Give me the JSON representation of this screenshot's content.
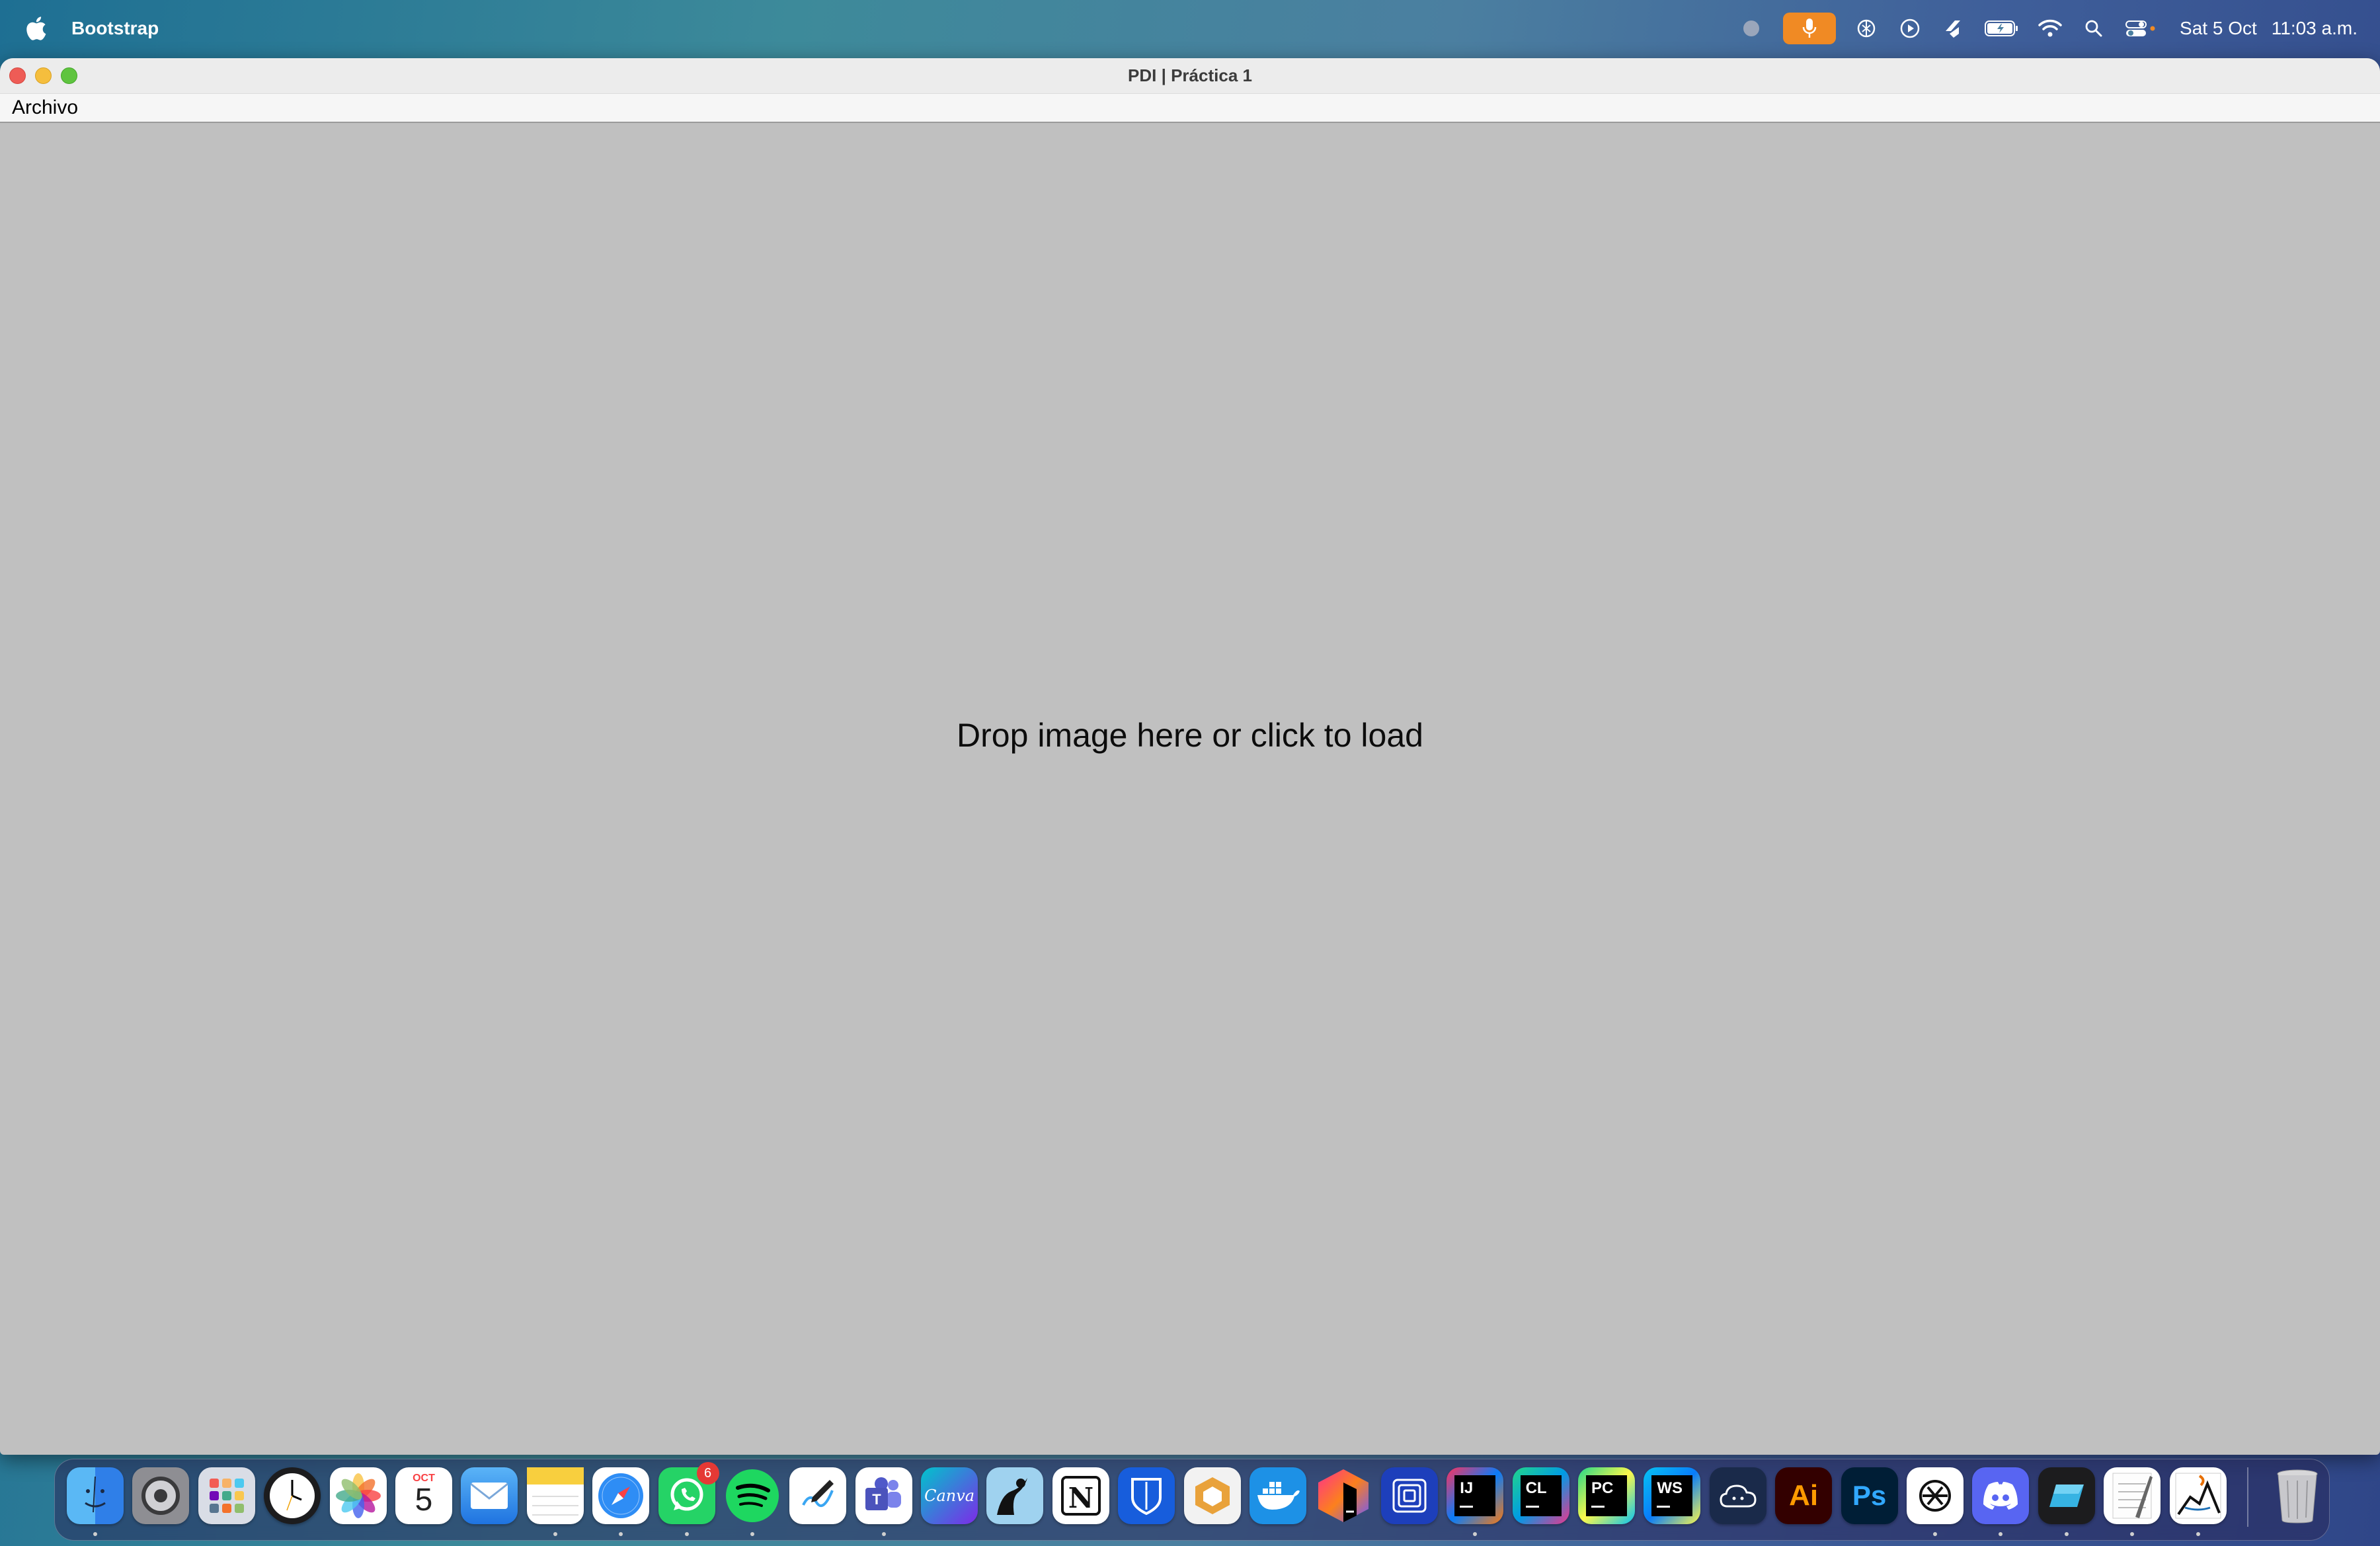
{
  "menubar": {
    "app_name": "Bootstrap",
    "date": "Sat 5 Oct",
    "time": "11:03 a.m.",
    "status_icons": [
      "record-indicator-icon",
      "microphone-icon",
      "chatgpt-icon",
      "play-circle-icon",
      "shortcut-icon",
      "battery-icon",
      "wifi-icon",
      "spotlight-search-icon",
      "control-center-icon"
    ]
  },
  "window": {
    "title": "PDI | Práctica 1",
    "menu": {
      "archivo": "Archivo"
    },
    "drop_zone_text": "Drop image here or click to load"
  },
  "dock": {
    "calendar": {
      "month": "OCT",
      "day": "5"
    },
    "whatsapp_badge": "6",
    "apps": [
      "finder",
      "system-settings",
      "launchpad",
      "clock",
      "photos",
      "calendar",
      "mail",
      "notes",
      "safari",
      "whatsapp",
      "spotify",
      "freeform",
      "teams",
      "canva",
      "kindle",
      "notion",
      "bitwarden",
      "dropzone",
      "docker",
      "jetbrains-toolbox",
      "framer",
      "intellij-idea",
      "clion",
      "pycharm",
      "webstorm",
      "ollama",
      "illustrator",
      "photoshop",
      "chatgpt",
      "discord",
      "xcode-like",
      "textedit",
      "java-launcher",
      "trash"
    ]
  }
}
